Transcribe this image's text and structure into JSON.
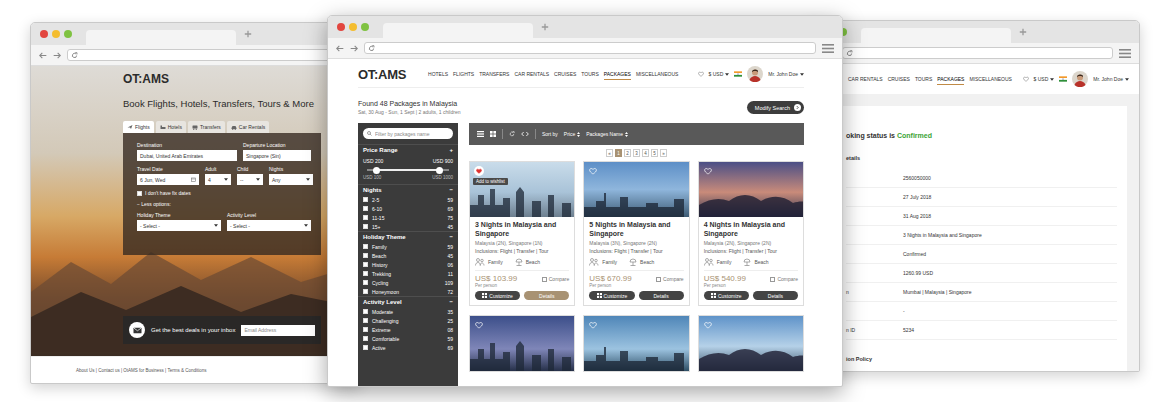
{
  "left_window": {
    "logo": "OT:AMS",
    "headline": "Book Flights, Hotels, Transfers, Tours & More",
    "search_tabs": [
      {
        "label": "Flights",
        "selected": true
      },
      {
        "label": "Hotels",
        "selected": false
      },
      {
        "label": "Transfers",
        "selected": false
      },
      {
        "label": "Car Rentals",
        "selected": false
      }
    ],
    "field_rows": [
      [
        {
          "label": "Destination",
          "value": "Dubai, United Arab Emirates",
          "kind": "text"
        },
        {
          "label": "Departure Location",
          "value": "Singapore (Sin)",
          "kind": "text"
        }
      ],
      [
        {
          "label": "Travel Date",
          "value": "6 Jun, Wed",
          "kind": "date"
        },
        {
          "label": "Adult",
          "value": "4",
          "kind": "select"
        },
        {
          "label": "Child",
          "value": "--",
          "kind": "select"
        },
        {
          "label": "Nights",
          "value": "Any",
          "kind": "select"
        }
      ]
    ],
    "fix_dates": {
      "label": "I don't have fix dates",
      "checked": false
    },
    "less_options": "− Less options:",
    "more_fields": [
      {
        "label": "Holiday Theme",
        "value": "- Select -",
        "kind": "select"
      },
      {
        "label": "Activity Level",
        "value": "- Select -",
        "kind": "select"
      }
    ],
    "newsletter": {
      "text": "Get the best deals in your inbox",
      "placeholder": "Email Address"
    },
    "footer": "About Us | Contact us | OtAMS for Business | Terms & Conditions"
  },
  "center_window": {
    "logo": "OT:AMS",
    "nav": [
      {
        "label": "HOTELS",
        "selected": false
      },
      {
        "label": "FLIGHTS",
        "selected": false
      },
      {
        "label": "TRANSFERS",
        "selected": false
      },
      {
        "label": "CAR RENTALS",
        "selected": false
      },
      {
        "label": "CRUISES",
        "selected": false
      },
      {
        "label": "TOURS",
        "selected": false
      },
      {
        "label": "PACKAGES",
        "selected": true
      },
      {
        "label": "MISCELLANEOUS",
        "selected": false
      }
    ],
    "currency": "$ USD",
    "user": "Mr. John Doe",
    "results_title": "Found 48 Packages in Malaysia",
    "results_sub": "Sat, 30 Aug - Sun, 1 Sept | 2 adults, 1 children",
    "modify_button": "Modify Search",
    "filter": {
      "placeholder": "Filter by packages name"
    },
    "price_range": {
      "title": "Price Range",
      "toggle": "+",
      "min_label": "USD 200",
      "max_label": "USD 900",
      "handles": [
        {
          "level": 0.11
        },
        {
          "level": 0.89
        }
      ],
      "scale_min": "USD 100",
      "scale_max": "USD 1000"
    },
    "filter_groups": [
      {
        "title": "Nights",
        "toggle": "−",
        "items": [
          {
            "label": "2-5",
            "count": "59",
            "checked": false
          },
          {
            "label": "6-10",
            "count": "69",
            "checked": false
          },
          {
            "label": "11-15",
            "count": "75",
            "checked": false
          },
          {
            "label": "15+",
            "count": "45",
            "checked": false
          }
        ]
      },
      {
        "title": "Holiday Theme",
        "toggle": "−",
        "items": [
          {
            "label": "Family",
            "count": "59",
            "checked": false
          },
          {
            "label": "Beach",
            "count": "45",
            "checked": false
          },
          {
            "label": "History",
            "count": "06",
            "checked": false
          },
          {
            "label": "Trekking",
            "count": "11",
            "checked": false
          },
          {
            "label": "Cycling",
            "count": "109",
            "checked": false
          },
          {
            "label": "Honeymoon",
            "count": "72",
            "checked": false
          }
        ]
      },
      {
        "title": "Activity Level",
        "toggle": "−",
        "items": [
          {
            "label": "Moderate",
            "count": "35",
            "checked": false
          },
          {
            "label": "Challenging",
            "count": "25",
            "checked": false
          },
          {
            "label": "Extreme",
            "count": "08",
            "checked": false
          },
          {
            "label": "Comfortable",
            "count": "59",
            "checked": false
          },
          {
            "label": "Active",
            "count": "69",
            "checked": false
          }
        ]
      }
    ],
    "sort": {
      "label": "Sort by",
      "options": [
        "Price",
        "Packages Name"
      ]
    },
    "pagination": [
      {
        "label": "«",
        "selected": false
      },
      {
        "label": "1",
        "selected": true
      },
      {
        "label": "2",
        "selected": false
      },
      {
        "label": "3",
        "selected": false
      },
      {
        "label": "4",
        "selected": false
      },
      {
        "label": "5",
        "selected": false
      },
      {
        "label": "»",
        "selected": false
      }
    ],
    "cards": [
      {
        "title": "3 Nights in Malaysia and Singapore",
        "subtitle": "Malaysia (2N), Singapore (1N)",
        "inclusions": "Inclusions: Flight | Transfer | Tour",
        "tags": [
          {
            "label": "Family",
            "kind": "family"
          },
          {
            "label": "Beach",
            "kind": "beach"
          }
        ],
        "price": "US$ 103.99",
        "price_note": "Per person",
        "compare": {
          "label": "Compare",
          "checked": false
        },
        "customize": "Customize",
        "details": "Details",
        "details_highlighted": true,
        "wishlisted": true,
        "tooltip": "Add to wishlist"
      },
      {
        "title": "5 Nights in Malaysia and Singapore",
        "subtitle": "Malaysia (3N), Singapore (2N)",
        "inclusions": "Inclusions: Flight | Transfer | Tour",
        "tags": [
          {
            "label": "Family",
            "kind": "family"
          },
          {
            "label": "Beach",
            "kind": "beach"
          }
        ],
        "price": "US$ 670.99",
        "price_note": "Per person",
        "compare": {
          "label": "Compare",
          "checked": false
        },
        "customize": "Customize",
        "details": "Details",
        "details_highlighted": false,
        "wishlisted": false
      },
      {
        "title": "4 Nights in Malaysia and Singapore",
        "subtitle": "Malaysia (2N), Singapore (2N)",
        "inclusions": "Inclusions: Flight | Transfer | Tour",
        "tags": [
          {
            "label": "Family",
            "kind": "family"
          },
          {
            "label": "Beach",
            "kind": "beach"
          }
        ],
        "price": "US$ 540.99",
        "price_note": "Per person",
        "compare": {
          "label": "Compare",
          "checked": false
        },
        "customize": "Customize",
        "details": "Details",
        "details_highlighted": false,
        "wishlisted": false
      }
    ],
    "more_cards": [
      {
        "wishlisted": false
      },
      {
        "wishlisted": false
      },
      {
        "wishlisted": false
      }
    ]
  },
  "right_window": {
    "nav": [
      {
        "label": "CAR RENTALS",
        "selected": false
      },
      {
        "label": "CRUISES",
        "selected": false
      },
      {
        "label": "TOURS",
        "selected": false
      },
      {
        "label": "PACKAGES",
        "selected": true
      },
      {
        "label": "MISCELLANEOUS",
        "selected": false
      }
    ],
    "currency": "$ USD",
    "user": "Mr. John Doe",
    "status_prefix": "oking status is ",
    "status": "Confirmed",
    "section": "etails",
    "rows": [
      {
        "label": "",
        "value": "2560050000"
      },
      {
        "label": "",
        "value": "27 July 2018"
      },
      {
        "label": "",
        "value": "31 Aug 2018"
      },
      {
        "label": "",
        "value": "3 Nights in Malaysia and Singapore"
      },
      {
        "label": "",
        "value": "Confirmed"
      },
      {
        "label": "",
        "value": "1260.99 USD"
      },
      {
        "label": "n",
        "value": "Mumbai | Malaysia | Singapore"
      },
      {
        "label": "",
        "value": "-"
      },
      {
        "label": "n ID",
        "value": "5234"
      }
    ],
    "policy_title": "ion Policy"
  }
}
